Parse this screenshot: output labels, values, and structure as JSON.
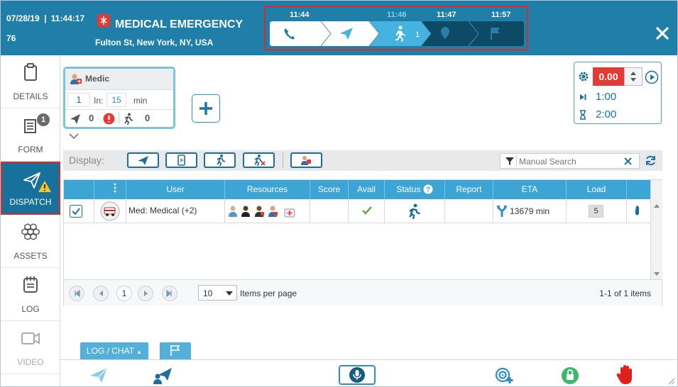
{
  "header": {
    "date": "07/28/19",
    "time": "11:44:17",
    "id": "76",
    "title": "MEDICAL EMERGENCY",
    "address": "Fulton St, New York, NY, USA",
    "colors": {
      "bar": "#1f7fa8",
      "badge": "#e53935"
    }
  },
  "timeline": {
    "times": [
      "11:44",
      "11:46",
      "11:47",
      "11:57"
    ],
    "steps": [
      {
        "icon": "phone-icon",
        "state": "done"
      },
      {
        "icon": "paper-plane-icon",
        "state": "done"
      },
      {
        "icon": "running-person-icon",
        "state": "current",
        "count": "1"
      },
      {
        "icon": "map-pin-icon",
        "state": "pending"
      },
      {
        "icon": "flag-icon",
        "state": "pending"
      }
    ]
  },
  "sidebar": {
    "items": [
      {
        "label": "DETAILS",
        "icon": "clipboard-icon"
      },
      {
        "label": "FORM",
        "icon": "form-icon",
        "badge": "1"
      },
      {
        "label": "DISPATCH",
        "icon": "paper-plane-icon",
        "warning": true
      },
      {
        "label": "ASSETS",
        "icon": "hexagons-icon"
      },
      {
        "label": "LOG",
        "icon": "notebook-icon"
      },
      {
        "label": "VIDEO",
        "icon": "video-camera-icon"
      }
    ]
  },
  "medic": {
    "title": "Medic",
    "quantity": "1",
    "in_label": "In:",
    "minutes": "15",
    "min_label": "min",
    "dispatched": "0",
    "responding": "0"
  },
  "timer": {
    "value": "0.00",
    "next": "1:00",
    "limit": "2:00"
  },
  "display": {
    "label": "Display:",
    "search_placeholder": "Manual Search"
  },
  "grid": {
    "columns": [
      "User",
      "Resources",
      "Score",
      "Avail",
      "Status",
      "Report",
      "ETA",
      "Load"
    ],
    "rows": [
      {
        "user": "Med: Medical (+2)",
        "score": "",
        "avail": "check",
        "status": "running",
        "report": "",
        "eta": "13679 min",
        "load": "5",
        "checked": true
      }
    ],
    "pager": {
      "page": "1",
      "page_size": "10",
      "per_page_label": "Items per page",
      "count_label": "1-1 of 1 items"
    }
  },
  "bottom": {
    "log_chat": "LOG / CHAT"
  }
}
